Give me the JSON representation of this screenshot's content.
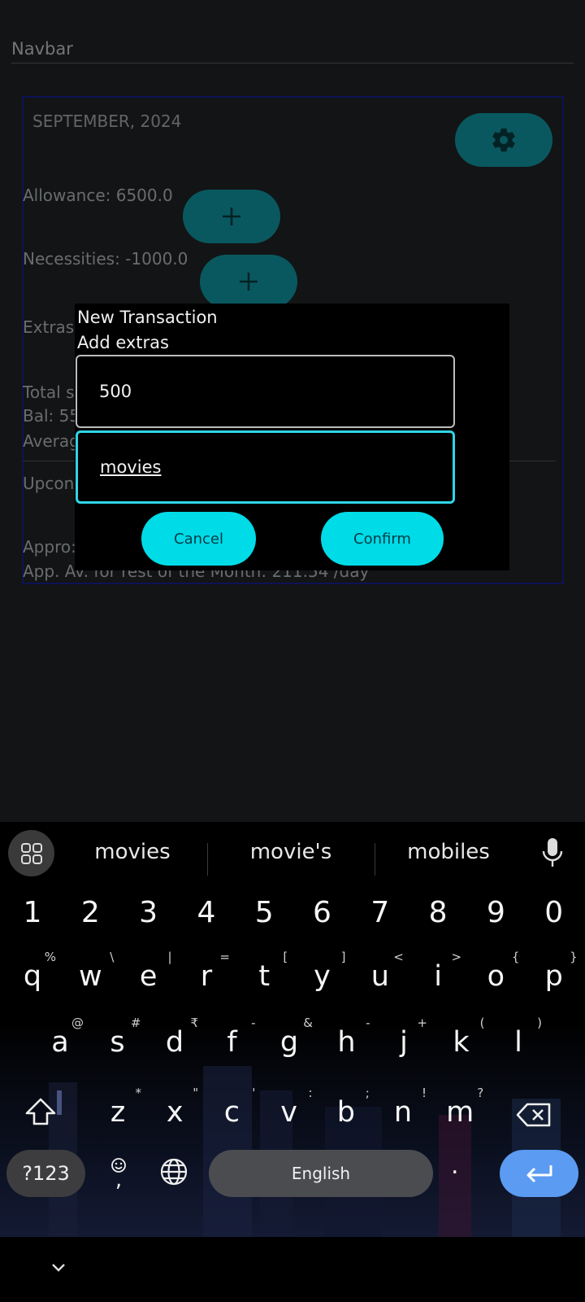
{
  "navbar": {
    "title": "Navbar"
  },
  "budget": {
    "month": "SEPTEMBER, 2024",
    "allowance": "Allowance: 6500.0",
    "necessities": "Necessities: -1000.0",
    "extras_partial": "Extras",
    "total_partial": "Total s",
    "bal_partial": "Bal: 55",
    "average_partial": "Averag",
    "upcoming_partial": "Upcon",
    "approx_partial": "Appro:",
    "app_av": "App. Av. for rest of the Month: 211.54 /day"
  },
  "dialog": {
    "title": "New Transaction",
    "subtitle": "Add extras",
    "amount_value": "500",
    "note_value": "movies",
    "cancel_label": "Cancel",
    "confirm_label": "Confirm"
  },
  "keyboard": {
    "suggestions": [
      "movies",
      "movie's",
      "mobiles"
    ],
    "numbers": [
      "1",
      "2",
      "3",
      "4",
      "5",
      "6",
      "7",
      "8",
      "9",
      "0"
    ],
    "row1": [
      {
        "k": "q",
        "a": "%"
      },
      {
        "k": "w",
        "a": "\\"
      },
      {
        "k": "e",
        "a": "|"
      },
      {
        "k": "r",
        "a": "="
      },
      {
        "k": "t",
        "a": "["
      },
      {
        "k": "y",
        "a": "]"
      },
      {
        "k": "u",
        "a": "<"
      },
      {
        "k": "i",
        "a": ">"
      },
      {
        "k": "o",
        "a": "{"
      },
      {
        "k": "p",
        "a": "}"
      }
    ],
    "row2": [
      {
        "k": "a",
        "a": "@"
      },
      {
        "k": "s",
        "a": "#"
      },
      {
        "k": "d",
        "a": "₹"
      },
      {
        "k": "f",
        "a": "-"
      },
      {
        "k": "g",
        "a": "&"
      },
      {
        "k": "h",
        "a": "-"
      },
      {
        "k": "j",
        "a": "+"
      },
      {
        "k": "k",
        "a": "("
      },
      {
        "k": "l",
        "a": ")"
      }
    ],
    "row3": [
      {
        "k": "z",
        "a": "*"
      },
      {
        "k": "x",
        "a": "\""
      },
      {
        "k": "c",
        "a": "'"
      },
      {
        "k": "v",
        "a": ":"
      },
      {
        "k": "b",
        "a": ";"
      },
      {
        "k": "n",
        "a": "!"
      },
      {
        "k": "m",
        "a": "?"
      }
    ],
    "symbols_label": "?123",
    "space_label": "English",
    "period_label": "."
  },
  "colors": {
    "accent": "#00dbe8",
    "teal_button": "#0f8f9a",
    "enter_key": "#5b9bf2"
  }
}
